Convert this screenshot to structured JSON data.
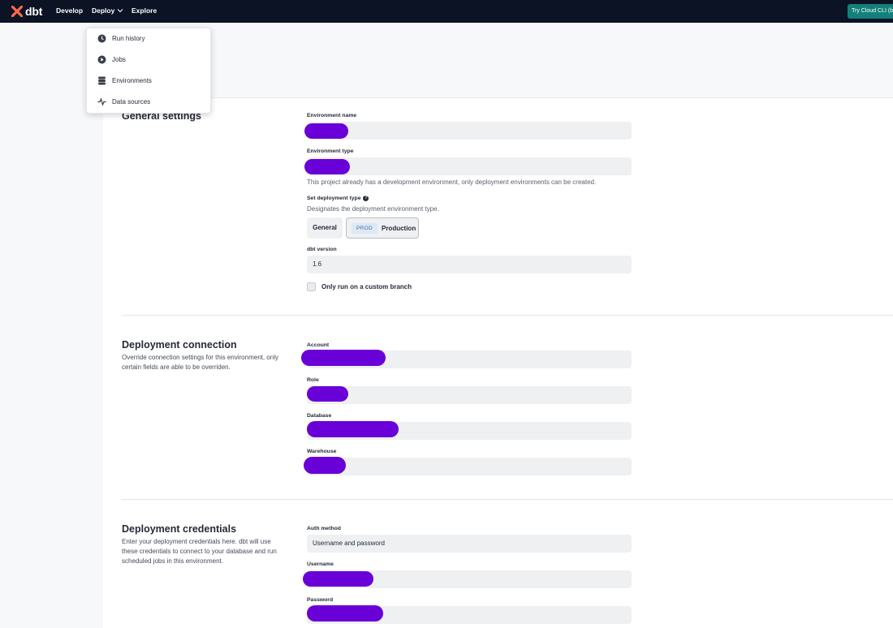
{
  "nav": {
    "logo_text": "dbt",
    "develop": "Develop",
    "deploy": "Deploy",
    "explore": "Explore",
    "cli_button": "Try Cloud CLI (beta)"
  },
  "dropdown": {
    "items": [
      {
        "label": "Run history",
        "icon": "clock-icon"
      },
      {
        "label": "Jobs",
        "icon": "play-icon"
      },
      {
        "label": "Environments",
        "icon": "database-icon"
      },
      {
        "label": "Data sources",
        "icon": "activity-icon"
      }
    ]
  },
  "general": {
    "title": "General settings",
    "env_name_label": "Environment name",
    "env_type_label": "Environment type",
    "env_type_help": "This project already has a development environment, only deployment environments can be created.",
    "deploy_type_label": "Set deployment type",
    "deploy_type_help": "Designates the deployment environment type.",
    "option_general": "General",
    "option_prod_badge": "PROD",
    "option_production": "Production",
    "dbt_version_label": "dbt version",
    "dbt_version_value": "1.6",
    "custom_branch_label": "Only run on a custom branch"
  },
  "connection": {
    "title": "Deployment connection",
    "description": "Override connection settings for this environment, only certain fields are able to be overriden.",
    "account_label": "Account",
    "role_label": "Role",
    "database_label": "Database",
    "warehouse_label": "Warehouse"
  },
  "credentials": {
    "title": "Deployment credentials",
    "description": "Enter your deployment credentials here. dbt will use these credentials to connect to your database and run scheduled jobs in this environment.",
    "auth_method_label": "Auth method",
    "auth_method_value": "Username and password",
    "username_label": "Username",
    "password_label": "Password"
  },
  "colors": {
    "nav_bg": "#0b1325",
    "brand_orange": "#ff694a",
    "cli_teal": "#13807a",
    "redaction": "#6a00d8"
  }
}
